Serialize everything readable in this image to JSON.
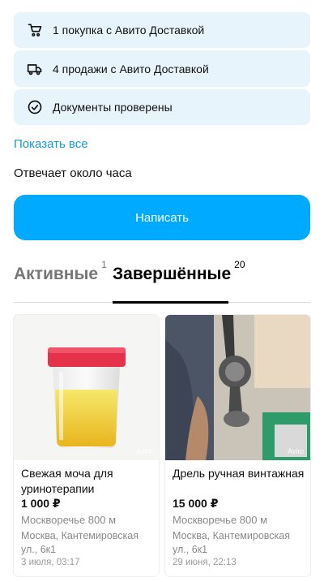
{
  "badges": [
    {
      "icon": "cart-icon",
      "text": "1 покупка с Авито Доставкой"
    },
    {
      "icon": "truck-icon",
      "text": "4 продажи с Авито Доставкой"
    },
    {
      "icon": "check-circle-icon",
      "text": "Документы проверены"
    }
  ],
  "show_all": "Показать все",
  "response_time": "Отвечает около часа",
  "write_button": "Написать",
  "tabs": {
    "active": {
      "label": "Активные",
      "count": "1"
    },
    "completed": {
      "label": "Завершённые",
      "count": "20"
    }
  },
  "listings": [
    {
      "title": "Свежая моча для уринотерапии",
      "price": "1 000 ₽",
      "metro": "Москворечье 800 м",
      "address": "Москва, Кантемировская ул., 6к1",
      "date": "3 июля, 03:17",
      "watermark": "Avito"
    },
    {
      "title": "Дрель ручная винтажная",
      "price": "15 000 ₽",
      "metro": "Москворечье 800 м",
      "address": "Москва, Кантемировская ул., 6к1",
      "date": "29 июня, 22:13",
      "watermark": "Avito"
    }
  ],
  "colors": {
    "accent": "#00aaff",
    "link": "#1a9ad6",
    "badge_bg": "#e8f4fc"
  }
}
